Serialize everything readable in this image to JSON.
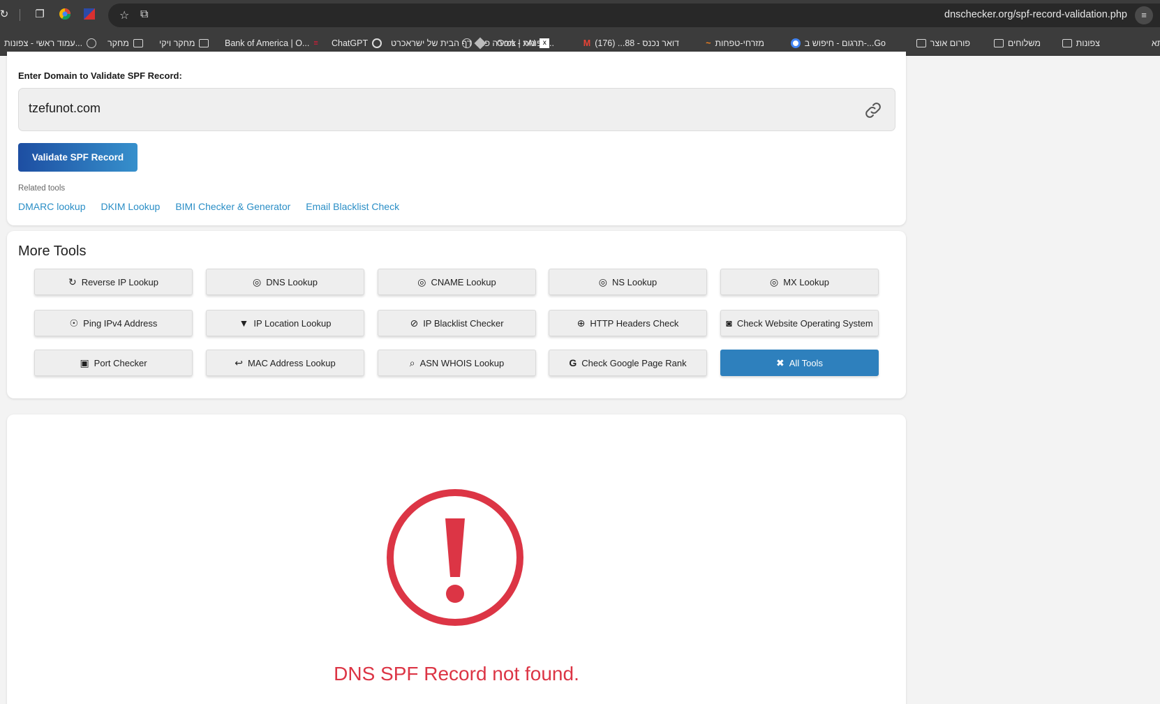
{
  "browser": {
    "url": "dnschecker.org/spf-record-validation.php",
    "bookmarks": [
      "פתא",
      "צפונות",
      "משלוחים",
      "פורום אוצר",
      "תרגום - חיפוש ב-...Go",
      "מזרחי-טפחות",
      "דואר נכנס - 88... (176)",
      "צפונות - מכירה פומ...",
      "Grok | xAI",
      "דף הבית של ישראכרט",
      "ChatGPT",
      "Bank of America | O...",
      "מחקר ויקי",
      "מחקר",
      "עמוד ראשי - צפונות..."
    ]
  },
  "form": {
    "label": "Enter Domain to Validate SPF Record:",
    "domain_value": "tzefunot.com",
    "validate_label": "Validate SPF Record",
    "related_title": "Related tools",
    "related_links": [
      "DMARC lookup",
      "DKIM Lookup",
      "BIMI Checker & Generator",
      "Email Blacklist Check"
    ]
  },
  "more_tools": {
    "title": "More Tools",
    "buttons": [
      {
        "label": "Reverse IP Lookup",
        "icon": "refresh-icon"
      },
      {
        "label": "DNS Lookup",
        "icon": "dns-icon"
      },
      {
        "label": "CNAME Lookup",
        "icon": "dns-icon"
      },
      {
        "label": "NS Lookup",
        "icon": "dns-icon"
      },
      {
        "label": "MX Lookup",
        "icon": "dns-icon"
      },
      {
        "label": "Ping IPv4 Address",
        "icon": "location-outline-icon"
      },
      {
        "label": "IP Location Lookup",
        "icon": "location-pin-icon"
      },
      {
        "label": "IP Blacklist Checker",
        "icon": "ban-icon"
      },
      {
        "label": "HTTP Headers Check",
        "icon": "globe-icon"
      },
      {
        "label": "Check Website Operating System",
        "icon": "shield-search-icon"
      },
      {
        "label": "Port Checker",
        "icon": "port-icon"
      },
      {
        "label": "MAC Address Lookup",
        "icon": "cable-icon"
      },
      {
        "label": "ASN WHOIS Lookup",
        "icon": "search-icon"
      },
      {
        "label": "Check Google Page Rank",
        "icon": "google-icon"
      },
      {
        "label": "All Tools",
        "icon": "tools-icon"
      }
    ]
  },
  "result": {
    "message": "DNS SPF Record not found.",
    "color": "#dc3545"
  }
}
